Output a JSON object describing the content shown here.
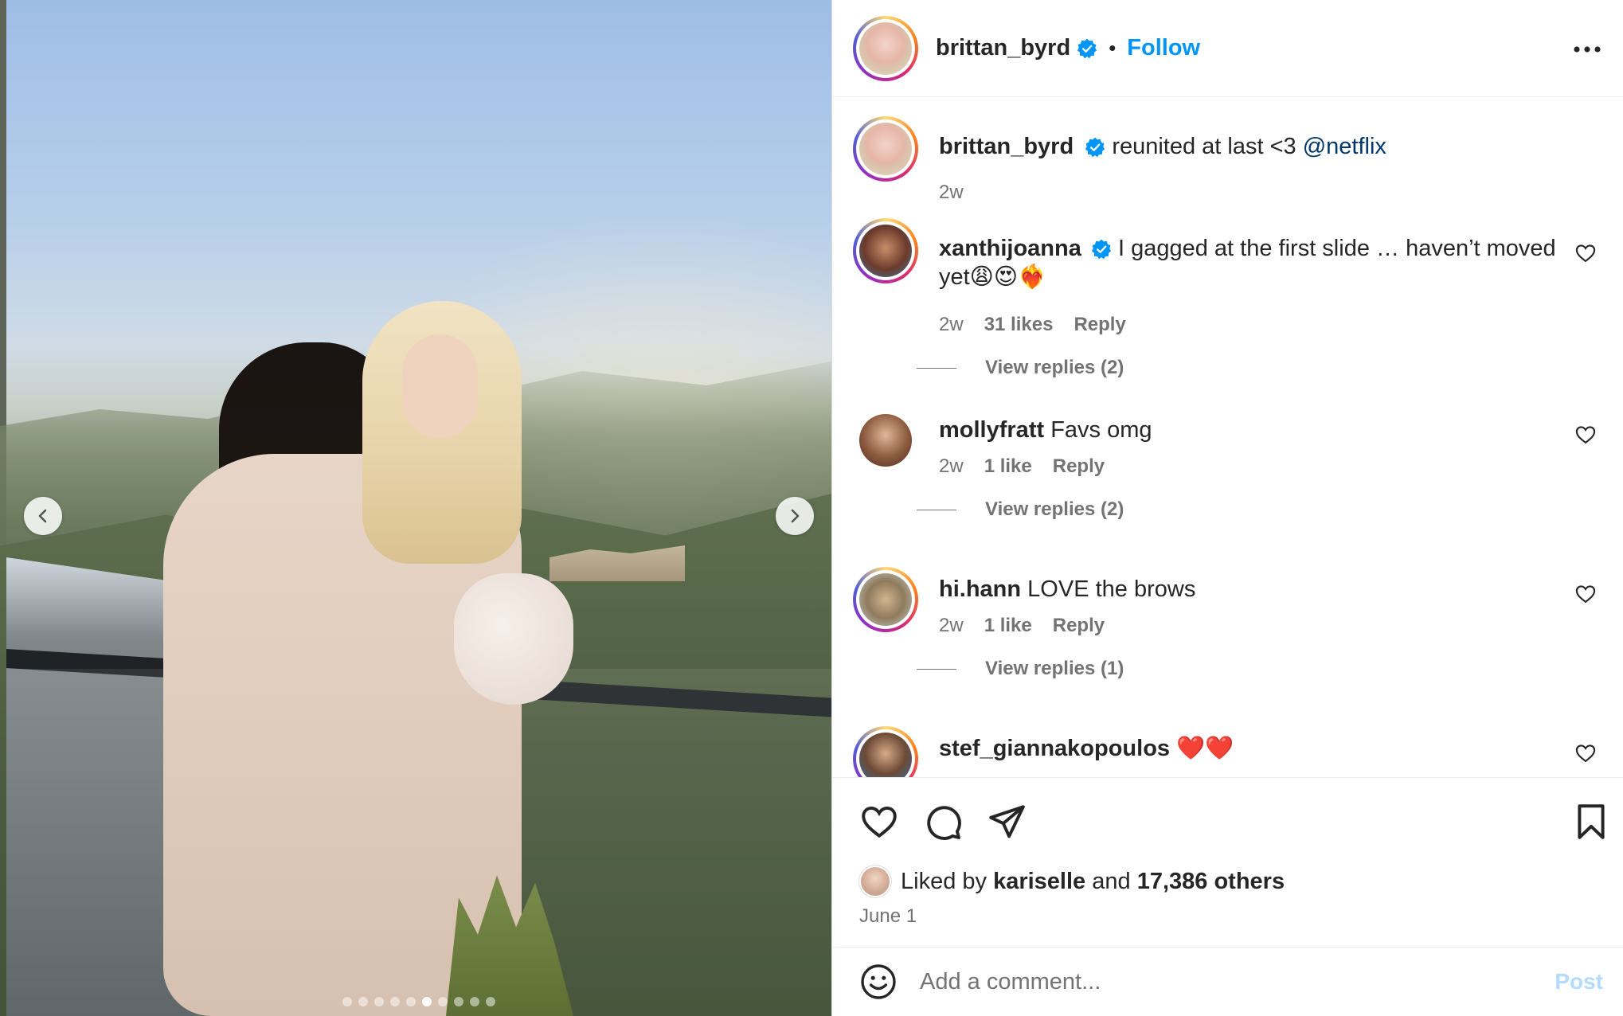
{
  "post": {
    "author": "brittan_byrd",
    "follow_label": "Follow",
    "separator": "•",
    "caption": "reunited at last <3",
    "caption_mention": "@netflix",
    "caption_time": "2w",
    "carousel": {
      "total_slides": 10,
      "active_index": 5
    }
  },
  "comments": [
    {
      "user": "xanthijoanna",
      "verified": true,
      "text": "I gagged at the first slide … haven’t moved yet😩😍❤️‍🔥",
      "time": "2w",
      "likes": "31 likes",
      "reply_label": "Reply",
      "view_replies": "View replies (2)"
    },
    {
      "user": "mollyfratt",
      "verified": false,
      "text": "Favs omg",
      "time": "2w",
      "likes": "1 like",
      "reply_label": "Reply",
      "view_replies": "View replies (2)"
    },
    {
      "user": "hi.hann",
      "verified": false,
      "text": "LOVE the brows",
      "time": "2w",
      "likes": "1 like",
      "reply_label": "Reply",
      "view_replies": "View replies (1)"
    },
    {
      "user": "stef_giannakopoulos",
      "verified": false,
      "text": "❤️❤️"
    }
  ],
  "engagement": {
    "liked_by_prefix": "Liked by",
    "liked_by_user": "kariselle",
    "and": "and",
    "others": "17,386 others",
    "date": "June 1"
  },
  "composer": {
    "placeholder": "Add a comment...",
    "post_label": "Post"
  },
  "colors": {
    "accent": "#0095f6",
    "verified": "#0095f6",
    "mention": "#00376b",
    "muted": "#737373",
    "post_disabled": "#b3dbff"
  },
  "icons": {
    "header_more": "more-horizontal-icon",
    "like": "heart-icon",
    "comment": "comment-bubble-icon",
    "share": "paper-plane-icon",
    "save": "bookmark-icon",
    "emoji": "smiley-icon",
    "prev": "chevron-left-icon",
    "next": "chevron-right-icon"
  }
}
